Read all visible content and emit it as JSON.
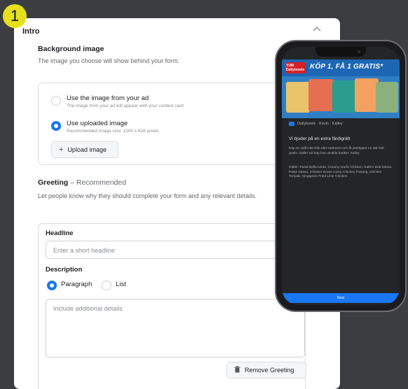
{
  "step_badge": "1",
  "panel": {
    "title": "Intro",
    "collapse_icon": "chevron-up-icon"
  },
  "background_image": {
    "title": "Background image",
    "description": "The image you choose will show behind your form.",
    "options": [
      {
        "label": "Use the image from your ad",
        "sub": "The image from your ad will appear with your context card",
        "selected": false
      },
      {
        "label": "Use uploaded image",
        "sub": "Recommended image size: 1200 x 628 pixels",
        "selected": true
      }
    ],
    "upload_button": "Upload image"
  },
  "greeting": {
    "title": "Greeting",
    "tag": "Recommended",
    "description": "Let people know why they should complete your form and any relevant details.",
    "headline_label": "Headline",
    "headline_placeholder": "Enter a short headline",
    "description_label": "Description",
    "format_options": [
      {
        "label": "Paragraph",
        "selected": true
      },
      {
        "label": "List",
        "selected": false
      }
    ],
    "details_placeholder": "Include additional details",
    "remove_button": "Remove Greeting"
  },
  "preview": {
    "ad_logo": "YUM Dailybowls",
    "ad_headline": "KÖP 1, FÅ 1 GRATIS*",
    "brand_line": "Dailybowls · Kevin · Kalley",
    "post_title": "Vi bjuder på en extra färdigrätt",
    "post_text_1": "Köp en valfri rätt från vårt sortiment och få ytterligare en rätt helt gratis. Gäller vid köp hos utvalda butiker. Kalley",
    "post_text_2": "Gäller: Pasta Bella Ivetta, Creamy Garlic Chicken, Kalle's Butt Sänsu, Paste Sänsu, Chicken Green Curry, Chicken Panang, Chicken Teriyaki, Singapore Fried Lime Chicken",
    "next_button": "Next"
  }
}
